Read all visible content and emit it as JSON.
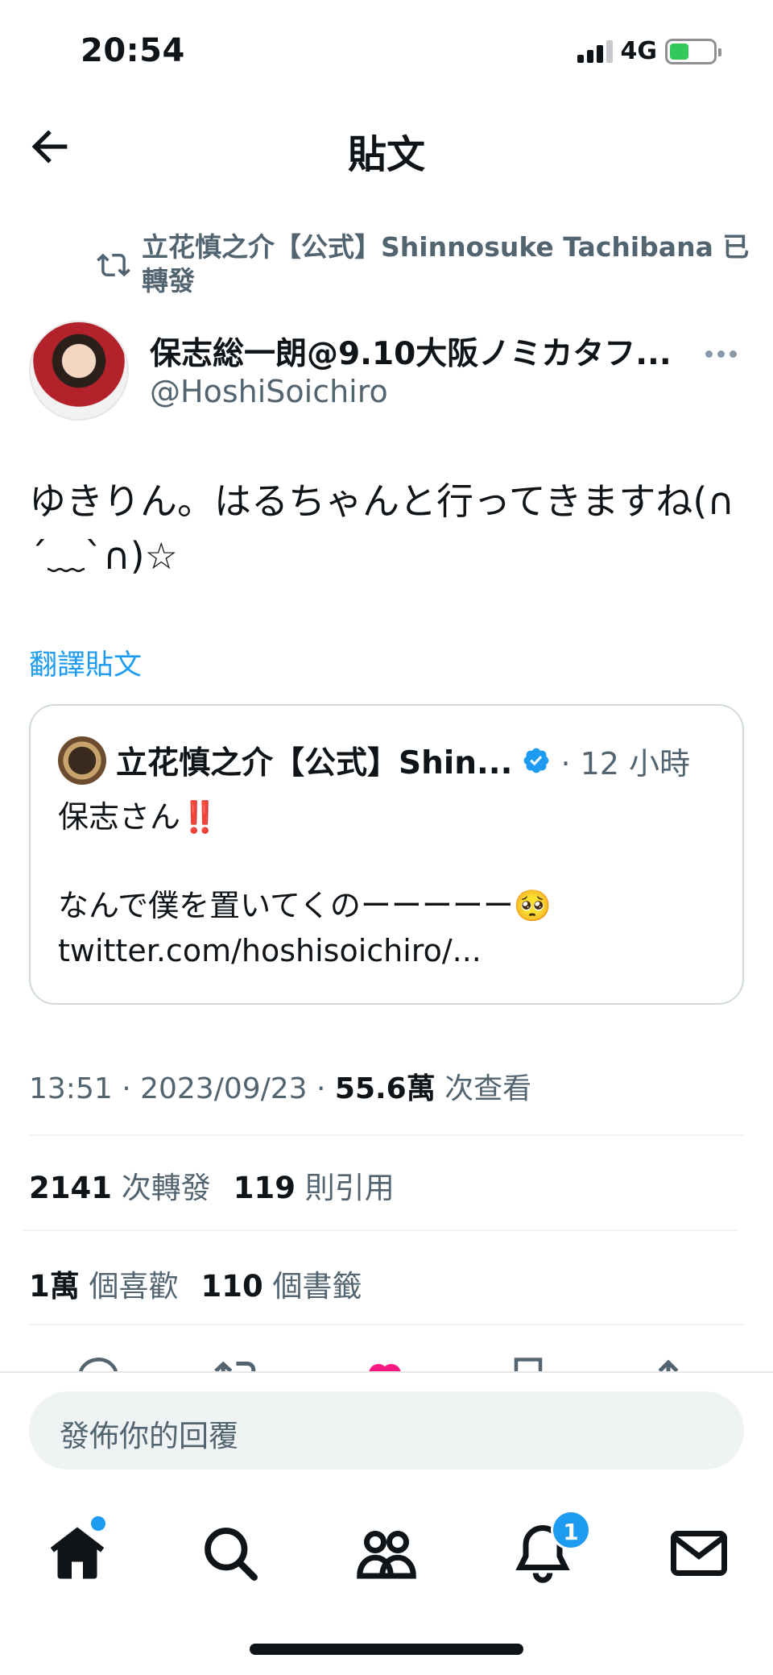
{
  "status_bar": {
    "time": "20:54",
    "network": "4G"
  },
  "header": {
    "title": "貼文"
  },
  "retweet": {
    "text": "立花慎之介【公式】Shinnosuke Tachibana 已轉發"
  },
  "post": {
    "author_name": "保志総一朗@9.10大阪ノミカタフ...",
    "author_handle": "@HoshiSoichiro",
    "text": "ゆきりん。はるちゃんと行ってきますね(∩´﹏`∩)☆",
    "translate_label": "翻譯貼文"
  },
  "quote": {
    "author_name": "立花慎之介【公式】Shin...",
    "time": "· 12 小時",
    "line1": "保志さん‼️",
    "line2": "なんで僕を置いてくのーーーーー🥺",
    "line3": "twitter.com/hoshisoichiro/..."
  },
  "meta": {
    "time": "13:51 · 2023/09/23 · ",
    "views_count": "55.6萬",
    "views_label": " 次查看"
  },
  "stats": {
    "retweets_count": "2141",
    "retweets_label": "次轉發",
    "quotes_count": "119",
    "quotes_label": "則引用",
    "likes_count": "1萬",
    "likes_label": "個喜歡",
    "bookmarks_count": "110",
    "bookmarks_label": "個書籤"
  },
  "reply": {
    "placeholder": "發佈你的回覆"
  },
  "tab_bar": {
    "notifications_badge": "1"
  },
  "colors": {
    "accent": "#1d9bf0",
    "like": "#f91880",
    "text": "#0f1419",
    "muted": "#536471"
  }
}
